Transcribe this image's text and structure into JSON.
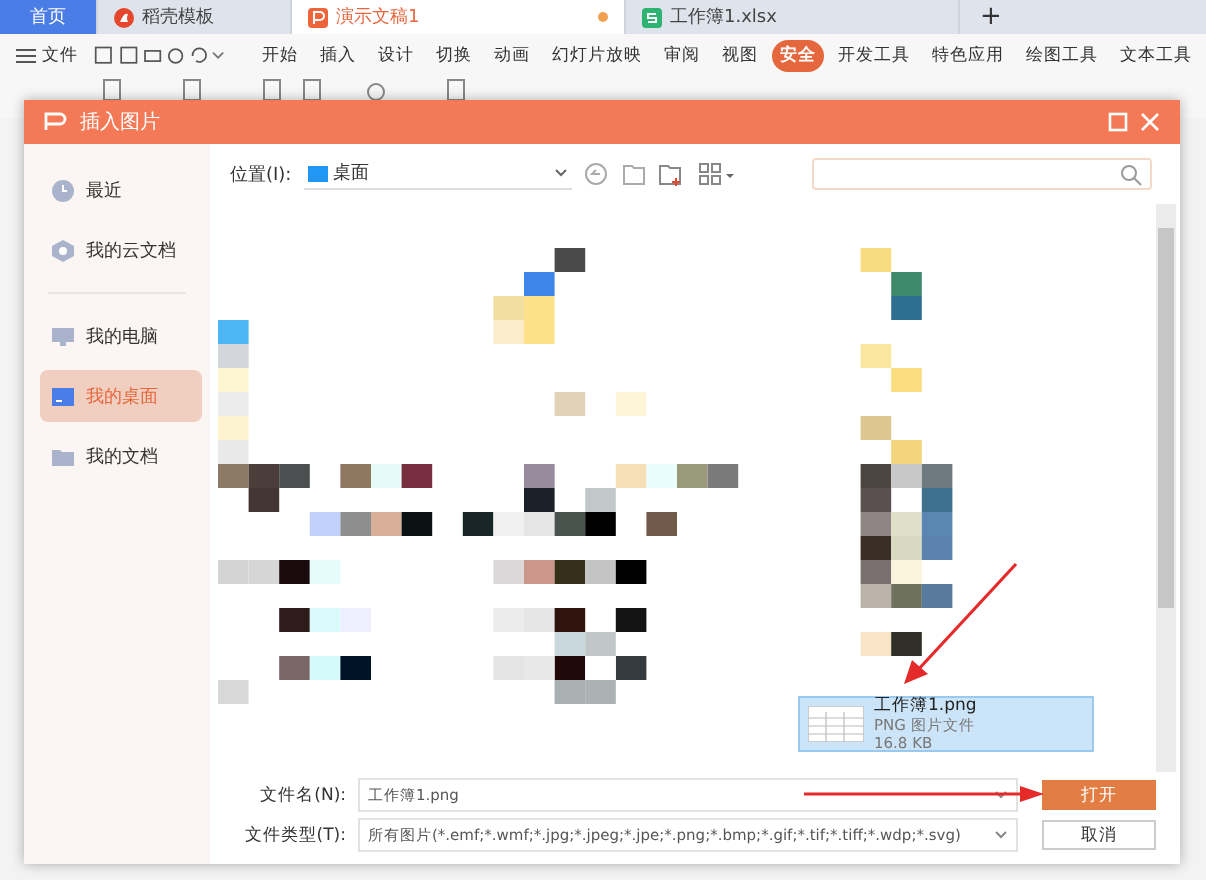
{
  "app_tabs": [
    {
      "label": "首页",
      "kind": "home",
      "selected": false,
      "modified": false
    },
    {
      "label": "稻壳模板",
      "kind": "docer",
      "selected": false,
      "modified": false
    },
    {
      "label": "演示文稿1",
      "kind": "slides",
      "selected": true,
      "modified": true
    },
    {
      "label": "工作簿1.xlsx",
      "kind": "sheet",
      "selected": false,
      "modified": false
    }
  ],
  "new_tab": "+",
  "menu": {
    "file": "文件",
    "items": [
      {
        "label": "开始",
        "highlighted": false
      },
      {
        "label": "插入",
        "highlighted": false
      },
      {
        "label": "设计",
        "highlighted": false
      },
      {
        "label": "切换",
        "highlighted": false
      },
      {
        "label": "动画",
        "highlighted": false
      },
      {
        "label": "幻灯片放映",
        "highlighted": false
      },
      {
        "label": "审阅",
        "highlighted": false
      },
      {
        "label": "视图",
        "highlighted": false
      },
      {
        "label": "安全",
        "highlighted": true
      },
      {
        "label": "开发工具",
        "highlighted": false
      },
      {
        "label": "特色应用",
        "highlighted": false
      },
      {
        "label": "绘图工具",
        "highlighted": false
      },
      {
        "label": "文本工具",
        "highlighted": false
      }
    ]
  },
  "dialog": {
    "title": "插入图片",
    "sidebar": [
      {
        "label": "最近",
        "kind": "clock",
        "selected": false
      },
      {
        "label": "我的云文档",
        "kind": "cloud",
        "selected": false
      },
      {
        "label": "我的电脑",
        "kind": "computer",
        "selected": false
      },
      {
        "label": "我的桌面",
        "kind": "desktop",
        "selected": true
      },
      {
        "label": "我的文档",
        "kind": "folder",
        "selected": false
      }
    ],
    "location_label": "位置(I):",
    "location": "桌面",
    "selected_file": {
      "name": "工作簿1.png",
      "type": "PNG 图片文件",
      "size": "16.8 KB",
      "selected": true
    },
    "filename_label": "文件名(N):",
    "filename": "工作簿1.png",
    "filetype_label": "文件类型(T):",
    "filetype": "所有图片(*.emf;*.wmf;*.jpg;*.jpeg;*.jpe;*.png;*.bmp;*.gif;*.tif;*.tiff;*.wdp;*.svg)",
    "buttons": [
      {
        "label": "打开",
        "kind": "primary"
      },
      {
        "label": "取消",
        "kind": "secondary"
      }
    ]
  }
}
